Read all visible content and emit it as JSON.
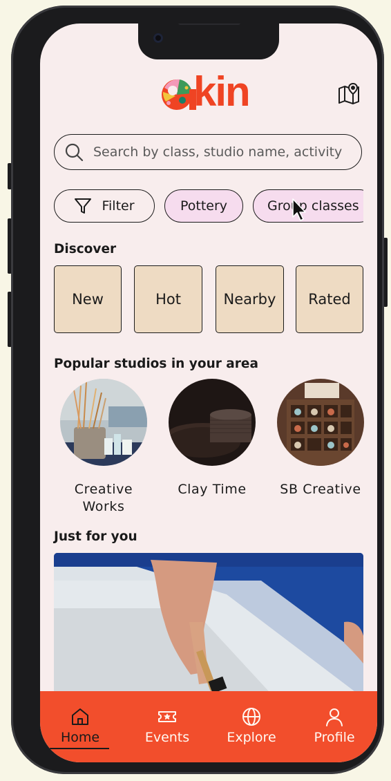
{
  "brand": {
    "name": "kin",
    "accent": "#ef4423",
    "screen_background": "#f8eded"
  },
  "header": {
    "map_button": {
      "icon": "map-icon"
    }
  },
  "search": {
    "icon": "search-icon",
    "placeholder": "Search by class, studio name, activity"
  },
  "chips": [
    {
      "label": "Filter",
      "icon": "filter-icon",
      "style": "outline"
    },
    {
      "label": "Pottery",
      "style": "tag"
    },
    {
      "label": "Group classes",
      "style": "tag"
    }
  ],
  "colors": {
    "chip_tag": "#f6dcee",
    "discover_tile": "#eedbc3",
    "tabbar": "#f24e2c"
  },
  "discover": {
    "title": "Discover",
    "tiles": [
      "New",
      "Hot",
      "Nearby",
      "Rated"
    ]
  },
  "popular": {
    "title": "Popular studios in your area",
    "studios": [
      {
        "name": "Creative Works"
      },
      {
        "name": "Clay Time"
      },
      {
        "name": "SB Creative"
      }
    ]
  },
  "just_for_you": {
    "title": "Just for you"
  },
  "tabbar": {
    "tabs": [
      {
        "label": "Home",
        "icon": "home-icon",
        "active": true
      },
      {
        "label": "Events",
        "icon": "ticket-icon",
        "active": false
      },
      {
        "label": "Explore",
        "icon": "globe-icon",
        "active": false
      },
      {
        "label": "Profile",
        "icon": "user-icon",
        "active": false
      }
    ]
  }
}
